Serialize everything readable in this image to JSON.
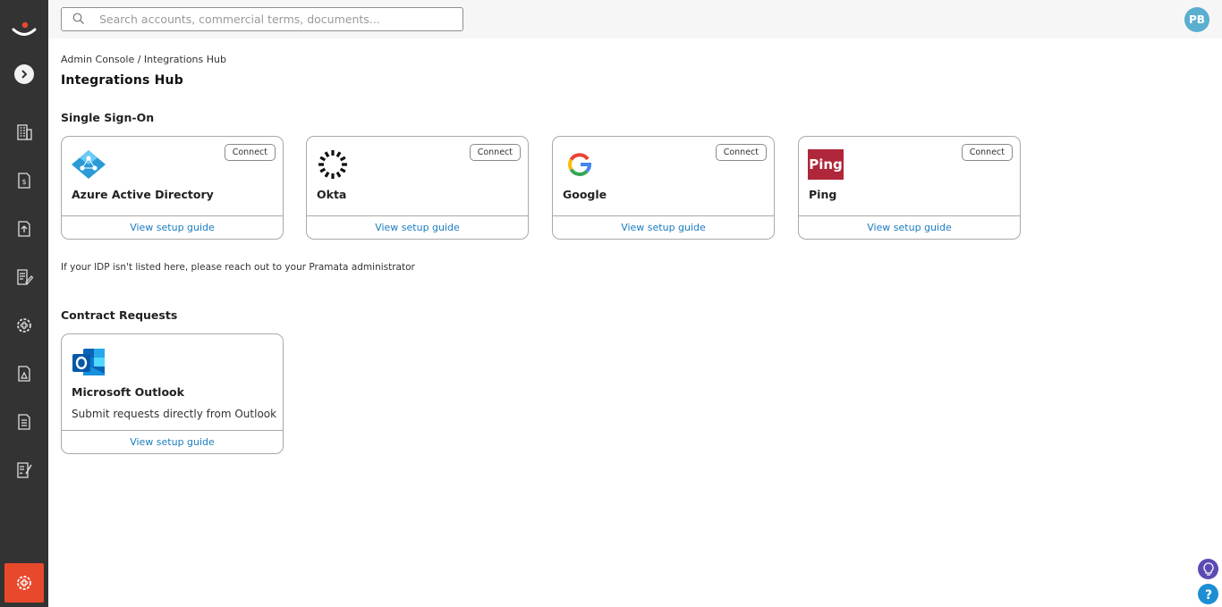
{
  "search": {
    "placeholder": "Search accounts, commercial terms, documents..."
  },
  "user": {
    "initials": "PB"
  },
  "breadcrumb": "Admin Console / Integrations Hub",
  "page_title": "Integrations Hub",
  "sso": {
    "title": "Single Sign-On",
    "cards": [
      {
        "name": "Azure Active Directory",
        "connect_label": "Connect",
        "guide_label": "View setup guide",
        "logo": "azure-ad-icon"
      },
      {
        "name": "Okta",
        "connect_label": "Connect",
        "guide_label": "View setup guide",
        "logo": "okta-icon"
      },
      {
        "name": "Google",
        "connect_label": "Connect",
        "guide_label": "View setup guide",
        "logo": "google-icon"
      },
      {
        "name": "Ping",
        "connect_label": "Connect",
        "guide_label": "View setup guide",
        "logo": "ping-icon",
        "logo_text": "Ping"
      }
    ],
    "note": "If your IDP isn't listed here, please reach out to your Pramata administrator"
  },
  "contract_requests": {
    "title": "Contract Requests",
    "cards": [
      {
        "name": "Microsoft Outlook",
        "description": "Submit requests directly from Outlook",
        "guide_label": "View setup guide",
        "logo": "outlook-icon"
      }
    ]
  },
  "colors": {
    "sidebar": "#333333",
    "accent": "#e8492c",
    "link": "#1a7cc1",
    "avatar": "#5aaed0"
  }
}
